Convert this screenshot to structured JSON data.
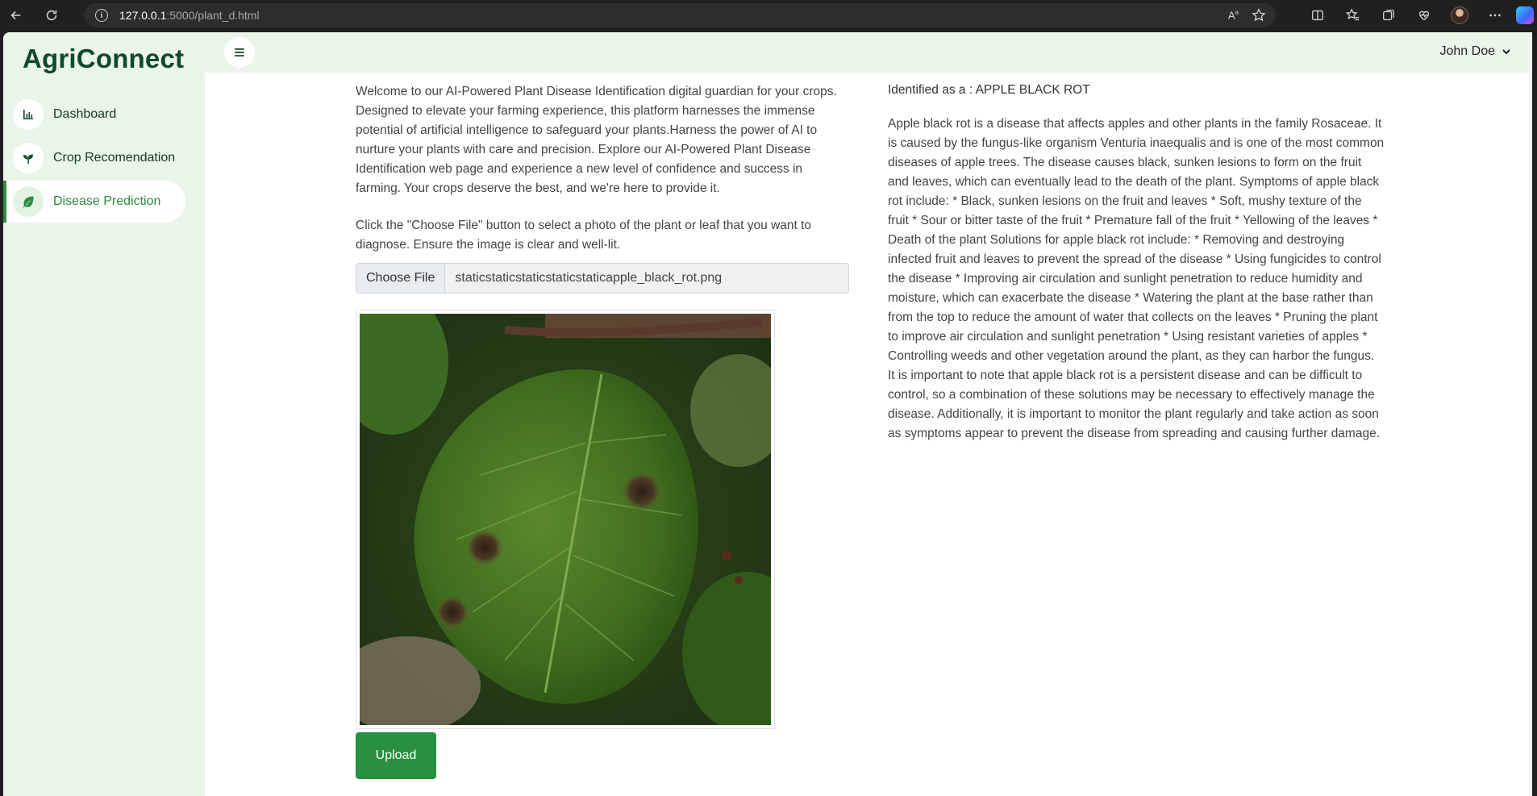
{
  "browser": {
    "url_host": "127.0.0.1",
    "url_rest": ":5000/plant_d.html"
  },
  "brand": "AgriConnect",
  "sidebar": {
    "items": [
      {
        "label": "Dashboard",
        "icon": "bar-chart-icon",
        "active": false
      },
      {
        "label": "Crop Recomendation",
        "icon": "sprout-icon",
        "active": false
      },
      {
        "label": "Disease Prediction",
        "icon": "leaf-icon",
        "active": true
      }
    ]
  },
  "topbar": {
    "user_name": "John Doe"
  },
  "main": {
    "intro": "Welcome to our AI-Powered Plant Disease Identification digital guardian for your crops. Designed to elevate your farming experience, this platform harnesses the immense potential of artificial intelligence to safeguard your plants.Harness the power of AI to nurture your plants with care and precision. Explore our AI-Powered Plant Disease Identification web page and experience a new level of confidence and success in farming. Your crops deserve the best, and we're here to provide it.",
    "instructions": "Click the \"Choose File\" button to select a photo of the plant or leaf that you want to diagnose. Ensure the image is clear and well-lit.",
    "file_button_label": "Choose File",
    "file_name": "staticstaticstaticstaticstaticapple_black_rot.png",
    "upload_label": "Upload"
  },
  "result": {
    "identified": "Identified as a : APPLE BLACK ROT",
    "description": "Apple black rot is a disease that affects apples and other plants in the family Rosaceae. It is caused by the fungus-like organism Venturia inaequalis and is one of the most common diseases of apple trees. The disease causes black, sunken lesions to form on the fruit and leaves, which can eventually lead to the death of the plant. Symptoms of apple black rot include: * Black, sunken lesions on the fruit and leaves * Soft, mushy texture of the fruit * Sour or bitter taste of the fruit * Premature fall of the fruit * Yellowing of the leaves * Death of the plant Solutions for apple black rot include: * Removing and destroying infected fruit and leaves to prevent the spread of the disease * Using fungicides to control the disease * Improving air circulation and sunlight penetration to reduce humidity and moisture, which can exacerbate the disease * Watering the plant at the base rather than from the top to reduce the amount of water that collects on the leaves * Pruning the plant to improve air circulation and sunlight penetration * Using resistant varieties of apples * Controlling weeds and other vegetation around the plant, as they can harbor the fungus. It is important to note that apple black rot is a persistent disease and can be difficult to control, so a combination of these solutions may be necessary to effectively manage the disease. Additionally, it is important to monitor the plant regularly and take action as soon as symptoms appear to prevent the disease from spreading and causing further damage."
  },
  "colors": {
    "brand": "#0f4a2a",
    "accent": "#2e8b3e",
    "sidebar_bg": "#eaf5ea",
    "upload_button": "#28903e"
  }
}
